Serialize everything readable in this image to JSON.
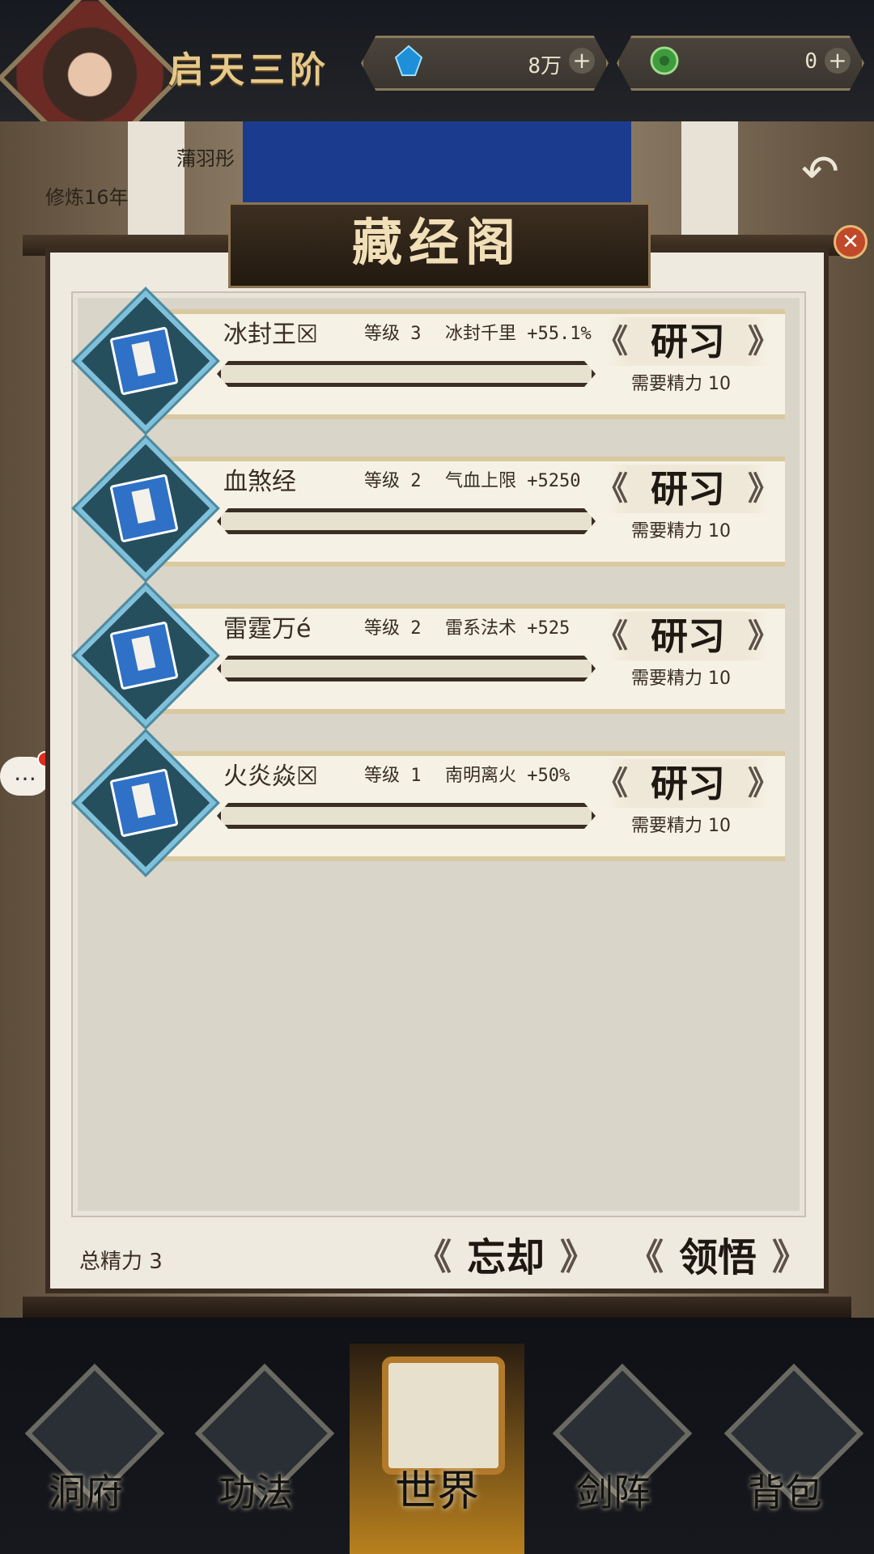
{
  "header": {
    "realm": "启天三阶",
    "resource_1": {
      "value": "8万",
      "icon": "blue-gem-icon"
    },
    "resource_2": {
      "value": "0",
      "icon": "green-jade-icon"
    }
  },
  "player": {
    "name": "蒲羽彤",
    "years": "修炼16年"
  },
  "panel": {
    "title": "藏经阁",
    "rows": [
      {
        "name": "冰封王☒",
        "level": "等级 3",
        "effect": "冰封千里 +55.1%",
        "action": "研习",
        "need": "需要精力 10"
      },
      {
        "name": "血煞经",
        "level": "等级 2",
        "effect": "气血上限 +5250",
        "action": "研习",
        "need": "需要精力 10"
      },
      {
        "name": "雷霆万é",
        "level": "等级 2",
        "effect": "雷系法术 +525",
        "action": "研习",
        "need": "需要精力 10"
      },
      {
        "name": "火炎焱☒",
        "level": "等级 1",
        "effect": "南明离火 +50%",
        "action": "研习",
        "need": "需要精力 10"
      }
    ],
    "total": "总精力 3",
    "forget_btn": "忘却",
    "comprehend_btn": "领悟"
  },
  "chat": {
    "label": "…"
  },
  "nav": [
    {
      "label": "洞府"
    },
    {
      "label": "功法"
    },
    {
      "label": "世界"
    },
    {
      "label": "剑阵"
    },
    {
      "label": "背包"
    }
  ],
  "colors": {
    "accent": "#e6c98a",
    "card": "#f5f1e5",
    "icon_bg": "#264f5e",
    "book": "#2f71c6"
  }
}
